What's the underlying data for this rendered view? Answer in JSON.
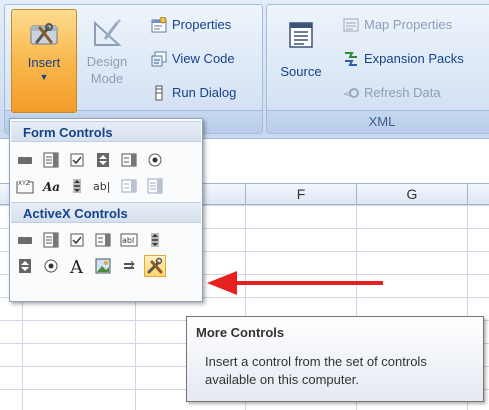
{
  "ribbon": {
    "controls_group": {
      "insert_label": "Insert",
      "design_mode_line1": "Design",
      "design_mode_line2": "Mode",
      "properties_label": "Properties",
      "view_code_label": "View Code",
      "run_dialog_label": "Run Dialog"
    },
    "xml_group": {
      "source_label": "Source",
      "map_properties_label": "Map Properties",
      "expansion_packs_label": "Expansion Packs",
      "refresh_data_label": "Refresh Data",
      "group_label": "XML"
    }
  },
  "sheet": {
    "columns": [
      "F",
      "G"
    ]
  },
  "dropdown": {
    "form_controls_header": "Form Controls",
    "activex_controls_header": "ActiveX Controls",
    "form_controls": [
      "button-icon",
      "combo-box-icon",
      "checkbox-icon",
      "spin-button-icon",
      "list-box-icon",
      "option-button-icon",
      "group-box-icon",
      "label-icon",
      "scroll-bar-icon",
      "text-field-icon",
      "combo-list-edit-icon",
      "combo-drop-down-edit-icon"
    ],
    "activex_controls": [
      "command-button-icon",
      "combo-box-icon",
      "checkbox-icon",
      "list-box-icon",
      "text-box-icon",
      "scroll-bar-icon",
      "spin-button-icon",
      "option-button-icon",
      "label-icon",
      "image-icon",
      "toggle-button-icon",
      "more-controls-icon"
    ]
  },
  "tooltip": {
    "title": "More Controls",
    "body": "Insert a control from the set of controls available on this computer."
  },
  "colors": {
    "arrow": "#e8201f",
    "accent_text": "#15428b",
    "pressed": "#f8b84c"
  }
}
